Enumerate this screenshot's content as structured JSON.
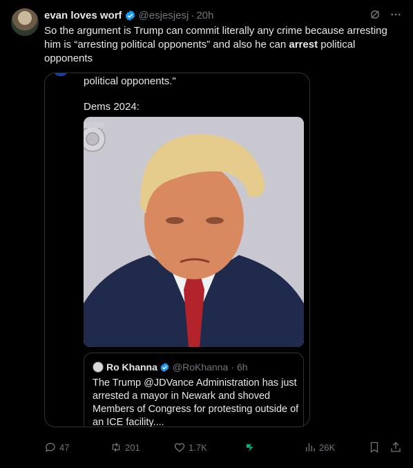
{
  "tweet": {
    "author_name": "evan loves worf",
    "handle": "@esjesjesj",
    "separator": "·",
    "time": "20h",
    "text_part1": "So the argument is Trump can commit literally any crime because arresting him is “arresting political opponents” and also he can ",
    "text_bold": "arrest",
    "text_part2": " political opponents"
  },
  "media": {
    "prev_text": "political opponents.\"",
    "dems_label": "Dems 2024:"
  },
  "quote": {
    "name": "Ro Khanna",
    "handle": "@RoKhanna",
    "separator": "·",
    "time": "6h",
    "text": "The Trump @JDVance Administration has just arrested a mayor in Newark and shoved Members of Congress for protesting outside of an ICE facility...."
  },
  "actions": {
    "replies": "47",
    "reposts": "201",
    "likes": "1.7K",
    "views": "26K"
  },
  "colors": {
    "background": "#000000",
    "text": "#e7e9ea",
    "muted": "#71767b",
    "verified": "#1d9bf0",
    "border": "#2f3336",
    "accent_green": "#00ba7c"
  },
  "icons": [
    "verified-badge-icon",
    "grok-icon",
    "more-icon",
    "reply-icon",
    "repost-icon",
    "like-icon",
    "app-icon",
    "views-icon",
    "bookmark-icon",
    "share-icon"
  ]
}
